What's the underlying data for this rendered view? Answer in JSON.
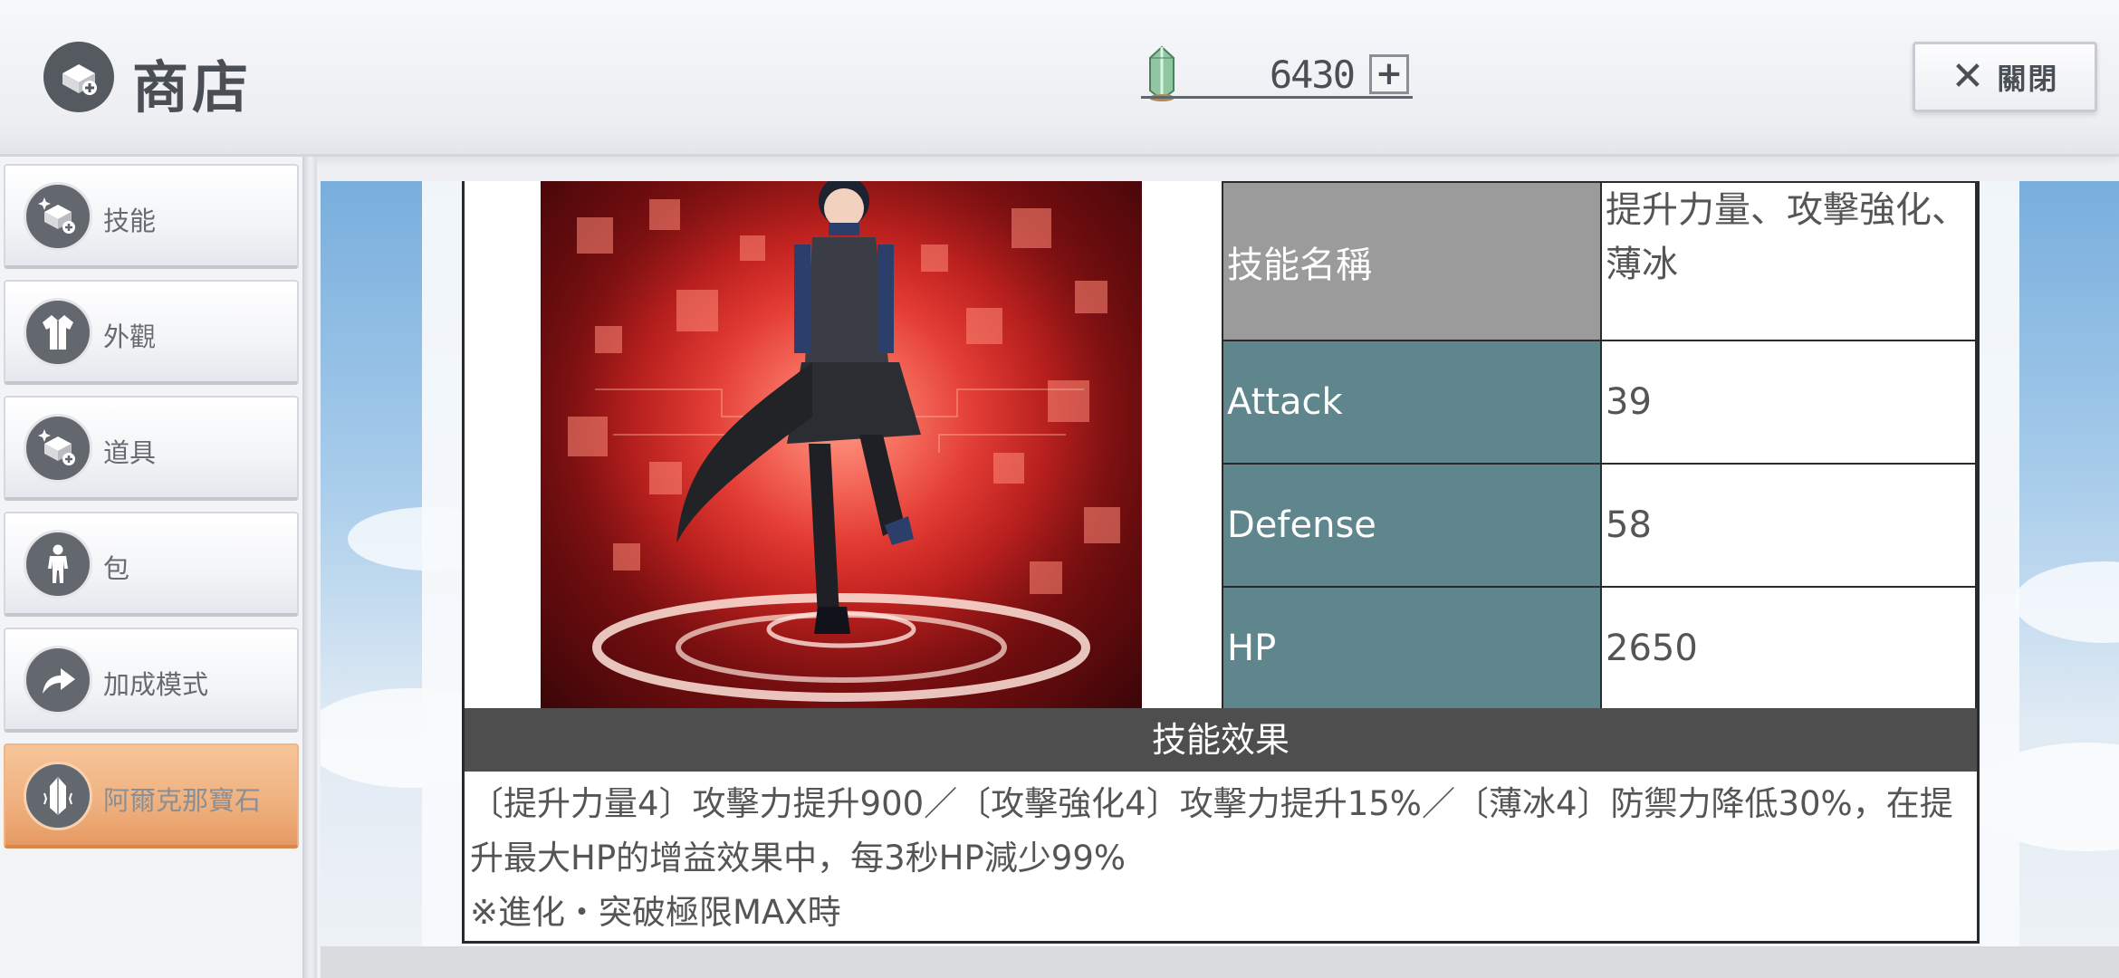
{
  "header": {
    "title": "商店",
    "currency": {
      "value": "6430",
      "plus": "+"
    },
    "close": {
      "icon": "✕",
      "label": "關閉"
    }
  },
  "sidebar": {
    "items": [
      {
        "label": "技能",
        "icon": "skill-icon",
        "active": false
      },
      {
        "label": "外觀",
        "icon": "costume-icon",
        "active": false
      },
      {
        "label": "道具",
        "icon": "item-icon",
        "active": false
      },
      {
        "label": "包",
        "icon": "person-icon",
        "active": false
      },
      {
        "label": "加成模式",
        "icon": "boost-arrow-icon",
        "active": true
      },
      {
        "label": "阿爾克那寶石",
        "icon": "crystal-icon",
        "active": true
      }
    ]
  },
  "card": {
    "stats": [
      {
        "label": "技能名稱",
        "value": "提升力量、攻擊強化、薄冰",
        "style": "grey"
      },
      {
        "label": "Attack",
        "value": "39",
        "style": "teal"
      },
      {
        "label": "Defense",
        "value": "58",
        "style": "teal"
      },
      {
        "label": "HP",
        "value": "2650",
        "style": "teal"
      }
    ],
    "effect_header": "技能效果",
    "effect_text": "〔提升力量4〕攻擊力提升900／〔攻擊強化4〕攻擊力提升15%／〔薄冰4〕防禦力降低30%，在提升最大HP的增益效果中，每3秒HP減少99%",
    "effect_note": "※進化・突破極限MAX時"
  },
  "colors": {
    "active_tab": "#efb07e",
    "grey_label": "#9b9b9b",
    "teal_label": "#5e868c",
    "effect_header_bg": "#4e4e4e"
  }
}
